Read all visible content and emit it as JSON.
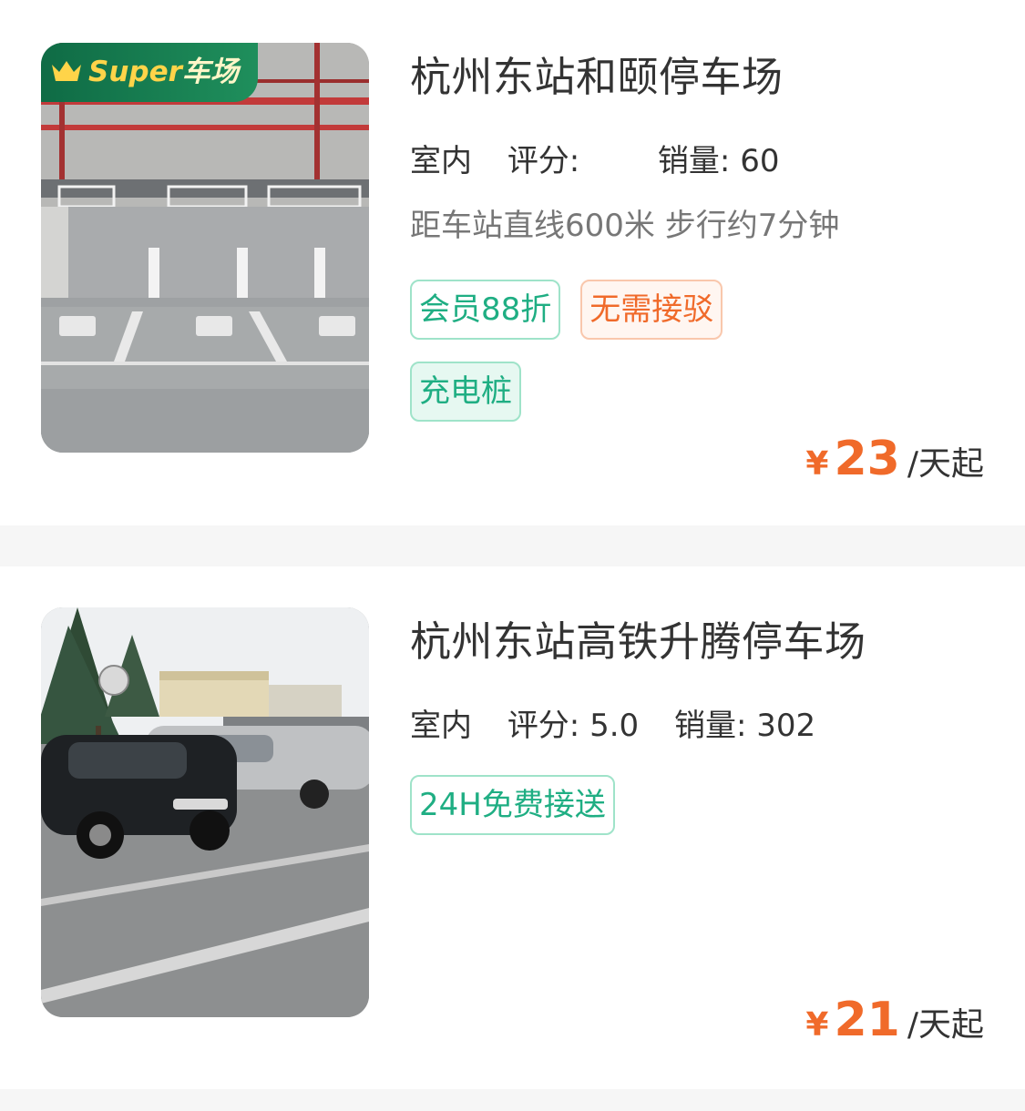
{
  "listings": [
    {
      "name": "杭州东站和颐停车场",
      "badge": {
        "super": "Super",
        "rest": "车场"
      },
      "type": "室内",
      "rating_label": "评分:",
      "rating_value": "",
      "sales_label": "销量:",
      "sales_value": "60",
      "distance": "距车站直线600米 步行约7分钟",
      "tags": [
        "会员88折",
        "无需接驳",
        "充电桩"
      ],
      "price_symbol": "¥",
      "price": "23",
      "price_unit": "/天起"
    },
    {
      "name": "杭州东站高铁升腾停车场",
      "type": "室内",
      "rating_label": "评分:",
      "rating_value": "5.0",
      "sales_label": "销量:",
      "sales_value": "302",
      "tags": [
        "24H免费接送"
      ],
      "price_symbol": "¥",
      "price": "21",
      "price_unit": "/天起"
    }
  ],
  "colors": {
    "accent_green": "#1fae83",
    "accent_orange": "#f06a2a"
  }
}
